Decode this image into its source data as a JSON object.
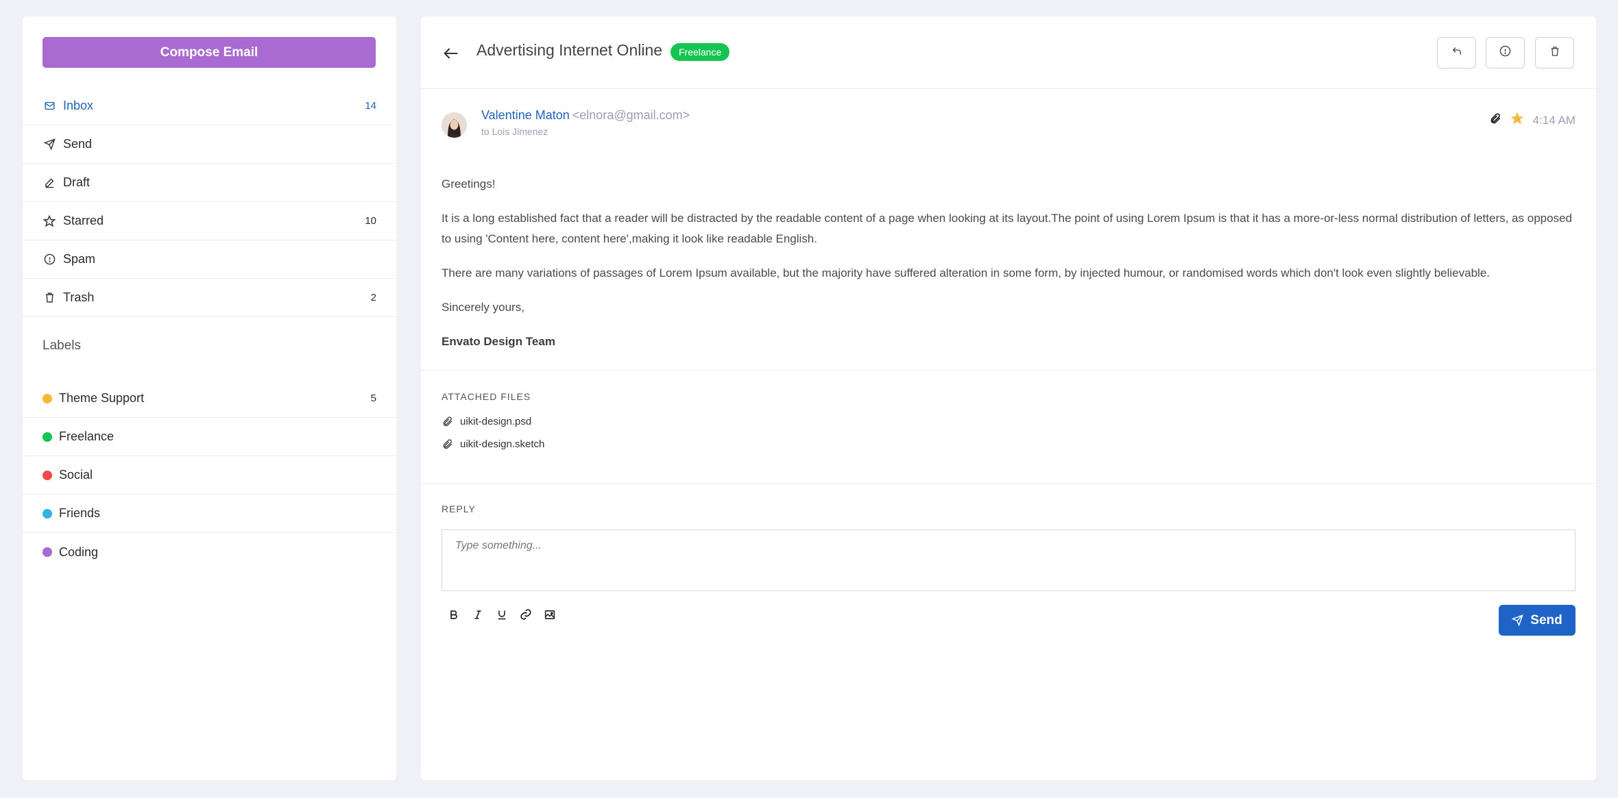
{
  "sidebar": {
    "compose_label": "Compose Email",
    "nav": [
      {
        "label": "Inbox",
        "count": "14",
        "icon": "mail-icon"
      },
      {
        "label": "Send",
        "count": "",
        "icon": "send-icon"
      },
      {
        "label": "Draft",
        "count": "",
        "icon": "pencil-icon"
      },
      {
        "label": "Starred",
        "count": "10",
        "icon": "star-icon"
      },
      {
        "label": "Spam",
        "count": "",
        "icon": "info-icon"
      },
      {
        "label": "Trash",
        "count": "2",
        "icon": "trash-icon"
      }
    ],
    "labels_title": "Labels",
    "labels": [
      {
        "label": "Theme Support",
        "count": "5",
        "color": "#fbb731"
      },
      {
        "label": "Freelance",
        "count": "",
        "color": "#16c452"
      },
      {
        "label": "Social",
        "count": "",
        "color": "#f04848"
      },
      {
        "label": "Friends",
        "count": "",
        "color": "#34b2e4"
      },
      {
        "label": "Coding",
        "count": "",
        "color": "#a96ad2"
      }
    ]
  },
  "mail": {
    "subject": "Advertising Internet Online",
    "tag": "Freelance",
    "sender_name": "Valentine Maton",
    "sender_email": "<elnora@gmail.com>",
    "to": "to Lois Jimenez",
    "time": "4:14 AM",
    "body": {
      "greeting": "Greetings!",
      "para1": "It is a long established fact that a reader will be distracted by the readable content of a page when looking at its layout.The point of using Lorem Ipsum is that it has a more-or-less normal distribution of letters, as opposed to using 'Content here, content here',making it look like readable English.",
      "para2": "There are many variations of passages of Lorem Ipsum available, but the majority have suffered alteration in some form, by injected humour, or randomised words which don't look even slightly believable.",
      "closing": "Sincerely yours,",
      "signature": "Envato Design Team"
    },
    "attachments_title": "ATTACHED FILES",
    "attachments": [
      "uikit-design.psd",
      "uikit-design.sketch"
    ],
    "reply_title": "REPLY",
    "reply_placeholder": "Type something...",
    "send_label": "Send"
  },
  "colors": {
    "accent": "#a96ad2",
    "primary": "#1f63c6",
    "link": "#2264b8",
    "star": "#f6b93b"
  }
}
